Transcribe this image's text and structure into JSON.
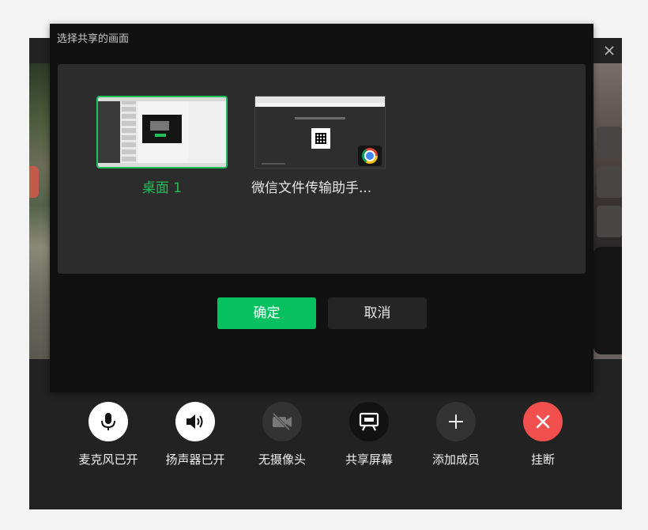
{
  "dialog": {
    "title": "选择共享的画面",
    "sources": [
      {
        "label": "桌面 1",
        "selected": true
      },
      {
        "label": "微信文件传输助手...",
        "selected": false,
        "badge_icon": "chrome-icon"
      }
    ],
    "confirm_label": "确定",
    "cancel_label": "取消"
  },
  "toolbar": {
    "items": [
      {
        "label": "麦克风已开",
        "icon": "microphone-icon",
        "style": "white"
      },
      {
        "label": "扬声器已开",
        "icon": "speaker-icon",
        "style": "white"
      },
      {
        "label": "无摄像头",
        "icon": "camera-off-icon",
        "style": "dark"
      },
      {
        "label": "共享屏幕",
        "icon": "screen-share-icon",
        "style": "darker"
      },
      {
        "label": "添加成员",
        "icon": "plus-icon",
        "style": "dark"
      },
      {
        "label": "挂断",
        "icon": "hangup-icon",
        "style": "red"
      }
    ]
  },
  "colors": {
    "accent_green": "#07c160",
    "selected_border": "#1fbf5a",
    "hangup_red": "#f24f4f"
  }
}
